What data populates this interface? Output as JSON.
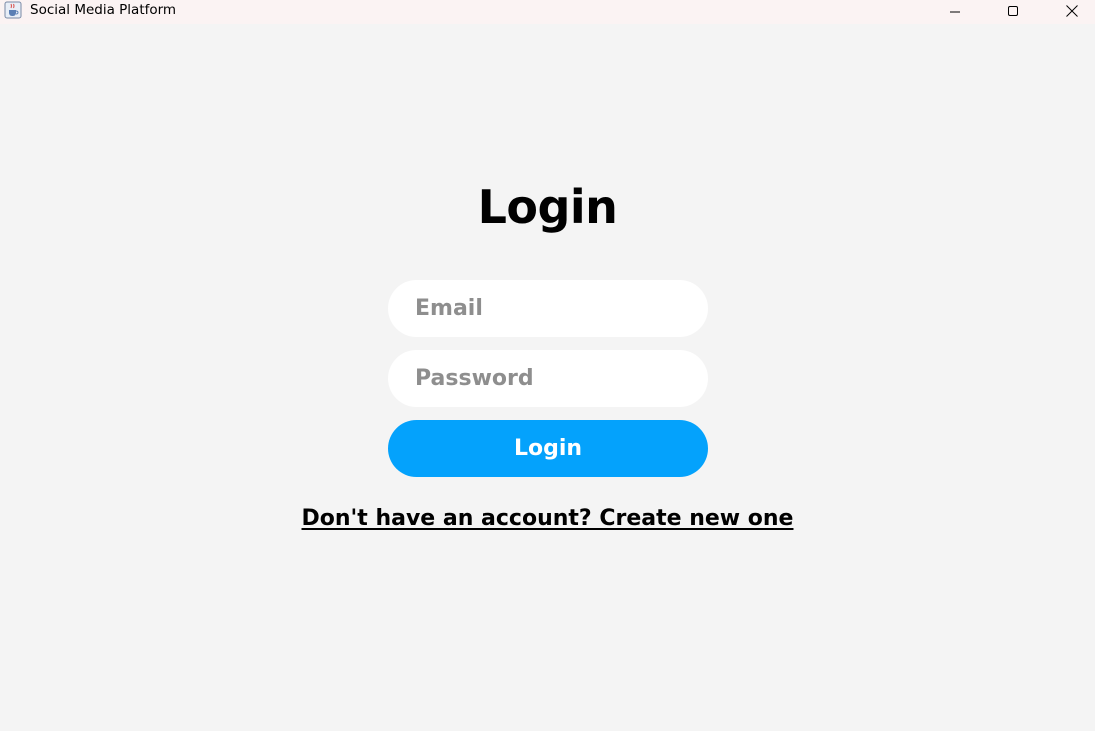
{
  "window": {
    "title": "Social Media Platform",
    "icon": "java-cup-icon",
    "controls": [
      "minimize-icon",
      "maximize-icon",
      "close-icon"
    ]
  },
  "login": {
    "heading": "Login",
    "email_placeholder": "Email",
    "email_value": "",
    "password_placeholder": "Password",
    "password_value": "",
    "button_label": "Login",
    "signup_link": "Don't have an account? Create new one"
  },
  "colors": {
    "accent": "#04a2fc",
    "background": "#f4f4f4",
    "field": "#ffffff",
    "placeholder": "#8e8e8e"
  }
}
